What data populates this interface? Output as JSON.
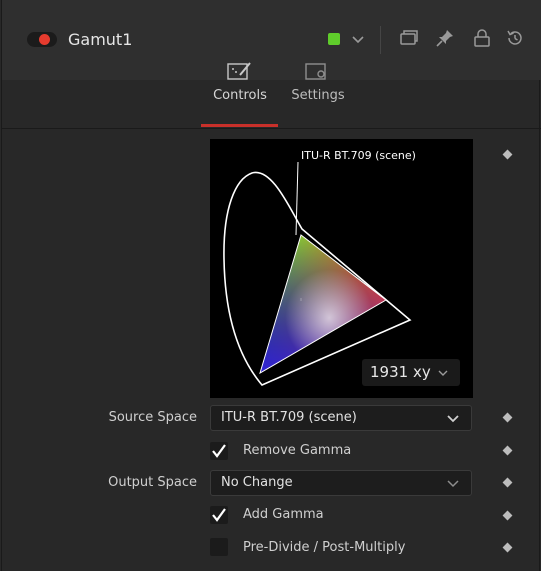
{
  "header": {
    "node_name": "Gamut1",
    "accent_color": "#5fcc2b",
    "toggle_color": "#e63b2e",
    "icons": [
      "chevron-down-icon",
      "window-icon",
      "pin-icon",
      "lock-icon",
      "reset-icon"
    ]
  },
  "tabs": [
    {
      "label": "Controls",
      "active": true,
      "icon": "controls-icon"
    },
    {
      "label": "Settings",
      "active": false,
      "icon": "settings-icon"
    }
  ],
  "gamut_view": {
    "label": "ITU-R BT.709 (scene)",
    "diagram_mode": "1931 xy"
  },
  "source_space": {
    "label": "Source Space",
    "value": "ITU-R BT.709 (scene)"
  },
  "remove_gamma": {
    "label": "Remove Gamma",
    "checked": true
  },
  "output_space": {
    "label": "Output Space",
    "value": "No Change"
  },
  "add_gamma": {
    "label": "Add Gamma",
    "checked": true
  },
  "pre_divide": {
    "label": "Pre-Divide / Post-Multiply",
    "checked": false
  }
}
